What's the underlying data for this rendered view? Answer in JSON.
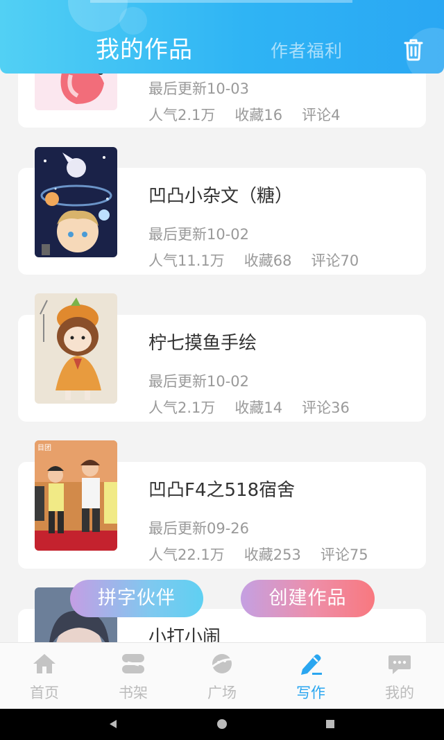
{
  "header": {
    "tab_works": "我的作品",
    "tab_welfare": "作者福利",
    "trash_icon": "trash-icon"
  },
  "works": [
    {
      "title": "",
      "updated": "最后更新10-03",
      "popularity": "人气2.1万",
      "favorites": "收藏16",
      "comments": "评论4"
    },
    {
      "title": "凹凸小杂文（糖）",
      "updated": "最后更新10-02",
      "popularity": "人气11.1万",
      "favorites": "收藏68",
      "comments": "评论70"
    },
    {
      "title": "柠七摸鱼手绘",
      "updated": "最后更新10-02",
      "popularity": "人气2.1万",
      "favorites": "收藏14",
      "comments": "评论36"
    },
    {
      "title": "凹凸F4之518宿舍",
      "updated": "最后更新09-26",
      "popularity": "人气22.1万",
      "favorites": "收藏253",
      "comments": "评论75"
    },
    {
      "title": "小打小闹"
    }
  ],
  "actions": {
    "partner": "拼字伙伴",
    "create": "创建作品"
  },
  "nav": [
    {
      "label": "首页",
      "icon": "home-icon"
    },
    {
      "label": "书架",
      "icon": "bookshelf-icon"
    },
    {
      "label": "广场",
      "icon": "planet-icon"
    },
    {
      "label": "写作",
      "icon": "pen-icon",
      "active": true
    },
    {
      "label": "我的",
      "icon": "chat-bubble-icon"
    }
  ],
  "colors": {
    "accent": "#2aa6f0",
    "header_gradient_start": "#52d0f4",
    "header_gradient_end": "#2aa7f3"
  }
}
